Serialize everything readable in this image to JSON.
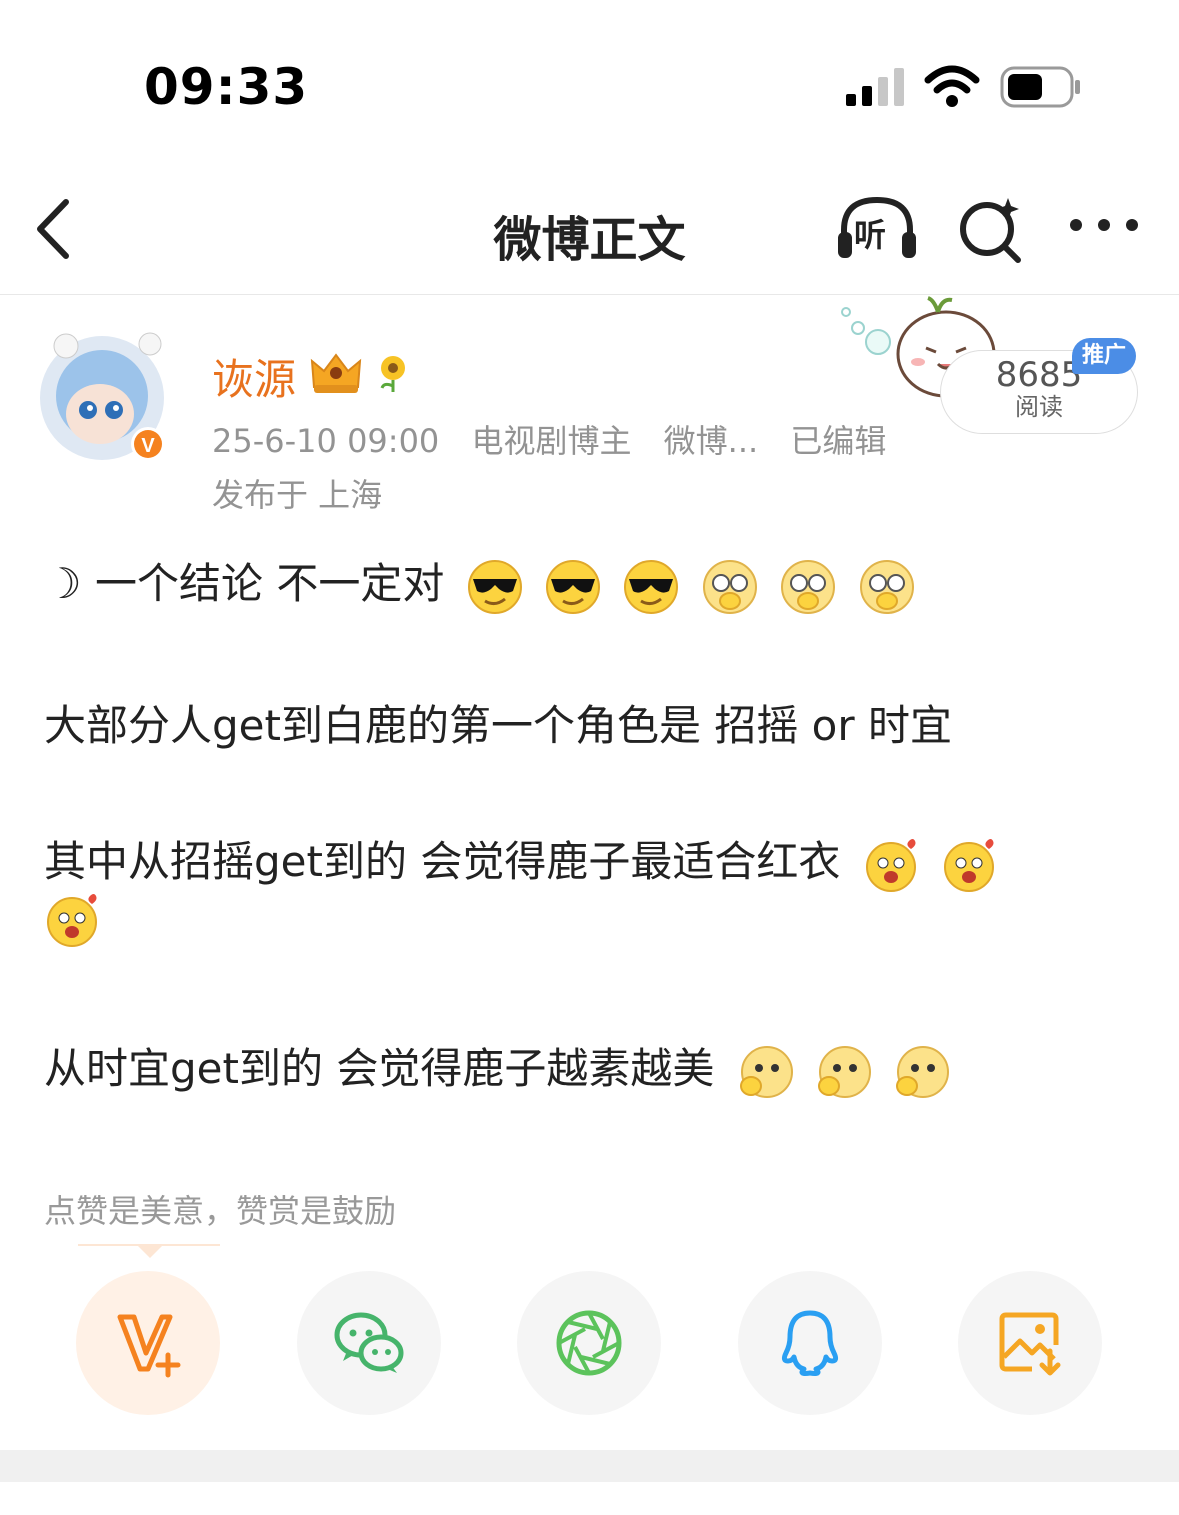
{
  "status_bar": {
    "time": "09:33"
  },
  "nav": {
    "title": "微博正文",
    "listen_label": "听"
  },
  "author": {
    "name": "诙源",
    "verified_mark": "V",
    "timestamp": "25-6-10 09:00",
    "role": "电视剧博主",
    "source": "微博...",
    "edited": "已编辑",
    "location": "发布于 上海"
  },
  "reads": {
    "count": "8685",
    "label": "阅读",
    "promo": "推广"
  },
  "post": {
    "line1": "☽ 一个结论 不一定对",
    "line2": "大部分人get到白鹿的第一个角色是 招摇 or 时宜",
    "line3": "其中从招摇get到的 会觉得鹿子最适合红衣",
    "line4": "从时宜get到的 会觉得鹿子越素越美"
  },
  "reward_text": "点赞是美意，赞赏是鼓励",
  "share_buttons": [
    {
      "name": "weibo-vplus",
      "icon": "v-plus-icon",
      "color": "#f5821f"
    },
    {
      "name": "wechat",
      "icon": "wechat-icon",
      "color": "#46b46b"
    },
    {
      "name": "moments",
      "icon": "moments-icon",
      "color": "#5cc35c"
    },
    {
      "name": "qq",
      "icon": "qq-icon",
      "color": "#2a9ff2"
    },
    {
      "name": "save-image",
      "icon": "save-image-icon",
      "color": "#f5a623"
    }
  ]
}
